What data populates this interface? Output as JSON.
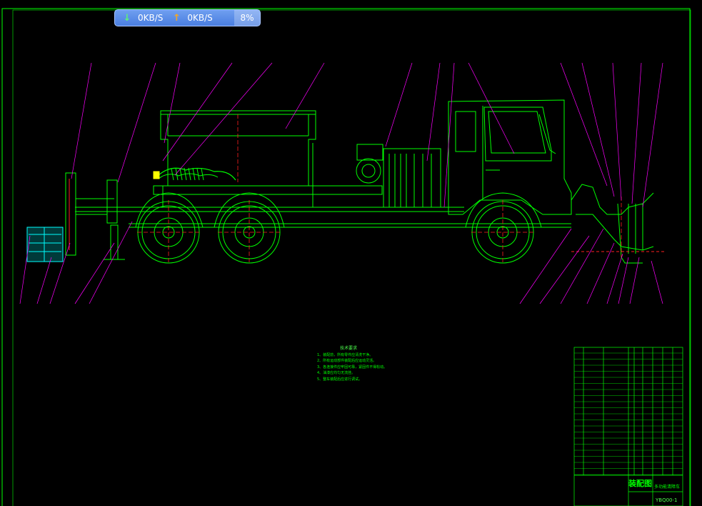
{
  "network_widget": {
    "download_speed": "0KB/S",
    "upload_speed": "0KB/S",
    "cpu_percent": "8%"
  },
  "drawing": {
    "technical_notes": {
      "title": "技术要求",
      "items": [
        "1、装配前，所有零件应清洗干净。",
        "2、所有运动部件装配后应运动灵活。",
        "3、各连接件应牢固可靠，紧固件不得松动。",
        "4、油漆应均匀无流挂。",
        "5、整车装配后应进行调试。"
      ]
    },
    "title_block": {
      "drawing_title": "装配图",
      "product_name": "多功能清障车",
      "drawing_code": "YBQ00-1"
    }
  },
  "colors": {
    "line": "#00ff00",
    "leader": "#ff00ff",
    "center": "#ff2020",
    "background": "#000000",
    "accent": "#00ffff"
  }
}
